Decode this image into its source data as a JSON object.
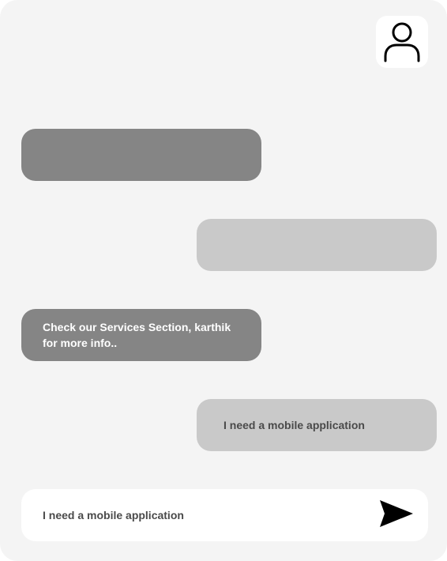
{
  "header": {
    "avatar_icon": "user-icon"
  },
  "messages": [
    {
      "direction": "incoming",
      "text": ""
    },
    {
      "direction": "outgoing",
      "text": ""
    },
    {
      "direction": "incoming",
      "text": "Check our Services Section, karthik for more info.."
    },
    {
      "direction": "outgoing",
      "text": "I need a mobile application"
    }
  ],
  "composer": {
    "value": "I need a mobile application",
    "send_icon": "send-icon"
  },
  "colors": {
    "background": "#f4f4f4",
    "incoming_bubble": "#858585",
    "outgoing_bubble": "#c9c9c9",
    "incoming_text": "#ffffff",
    "outgoing_text": "#4a4a4a"
  }
}
